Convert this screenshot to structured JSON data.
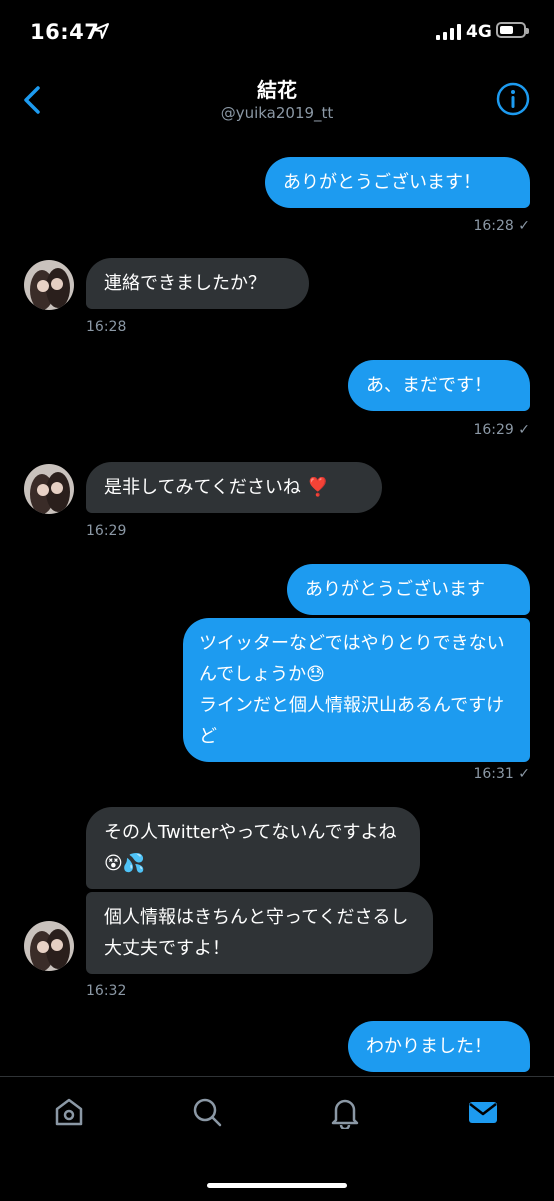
{
  "status_bar": {
    "time": "16:47",
    "network": "4G",
    "battery_level": 0.6
  },
  "header": {
    "title": "結花",
    "handle": "@yuika2019_tt"
  },
  "messages": [
    {
      "dir": "out",
      "text": "ありがとうございます！",
      "time": "16:28"
    },
    {
      "dir": "in",
      "text": "連絡できましたか？",
      "time": "16:28"
    },
    {
      "dir": "out",
      "text": "あ、まだです！",
      "time": "16:29"
    },
    {
      "dir": "in",
      "text": "是非してみてくださいね ❣️",
      "time": "16:29"
    },
    {
      "dir": "out",
      "text": "ありがとうございます"
    },
    {
      "dir": "out",
      "text": "ツイッターなどではやりとりできないんでしょうか😓\nラインだと個人情報沢山あるんですけど",
      "time": "16:31"
    },
    {
      "dir": "in",
      "text": "その人Twitterやってないんですよね😵💦"
    },
    {
      "dir": "in",
      "text": "個人情報はきちんと守ってくださるし大丈夫ですよ！",
      "time": "16:32"
    },
    {
      "dir": "out",
      "text": "わかりました！"
    }
  ],
  "tabs": [
    "home-icon",
    "search-icon",
    "notifications-icon",
    "messages-icon"
  ],
  "colors": {
    "accent": "#1d9bf0",
    "incoming": "#2f3336",
    "muted": "#8b98a5"
  }
}
